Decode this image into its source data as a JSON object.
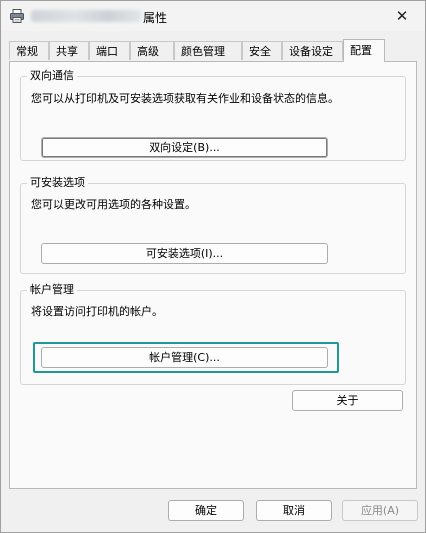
{
  "window": {
    "title": "属性",
    "close_glyph": "✕"
  },
  "tabs": [
    {
      "label": "常规",
      "active": false
    },
    {
      "label": "共享",
      "active": false
    },
    {
      "label": "端口",
      "active": false
    },
    {
      "label": "高级",
      "active": false
    },
    {
      "label": "颜色管理",
      "active": false
    },
    {
      "label": "安全",
      "active": false
    },
    {
      "label": "设备设定",
      "active": false
    },
    {
      "label": "配置",
      "active": true
    }
  ],
  "groups": {
    "bidirectional": {
      "title": "双向通信",
      "description": "您可以从打印机及可安装选项获取有关作业和设备状态的信息。",
      "button": "双向设定(B)..."
    },
    "installable": {
      "title": "可安装选项",
      "description": "您可以更改可用选项的各种设置。",
      "button": "可安装选项(I)..."
    },
    "account": {
      "title": "帐户管理",
      "description": "将设置访问打印机的帐户。",
      "button": "帐户管理(C)..."
    }
  },
  "about_button": "关于",
  "footer": {
    "ok": "确定",
    "cancel": "取消",
    "apply": "应用(A)"
  },
  "colors": {
    "highlight_border": "#1c9a93"
  },
  "icons": {
    "title_icon": "printer-icon"
  }
}
